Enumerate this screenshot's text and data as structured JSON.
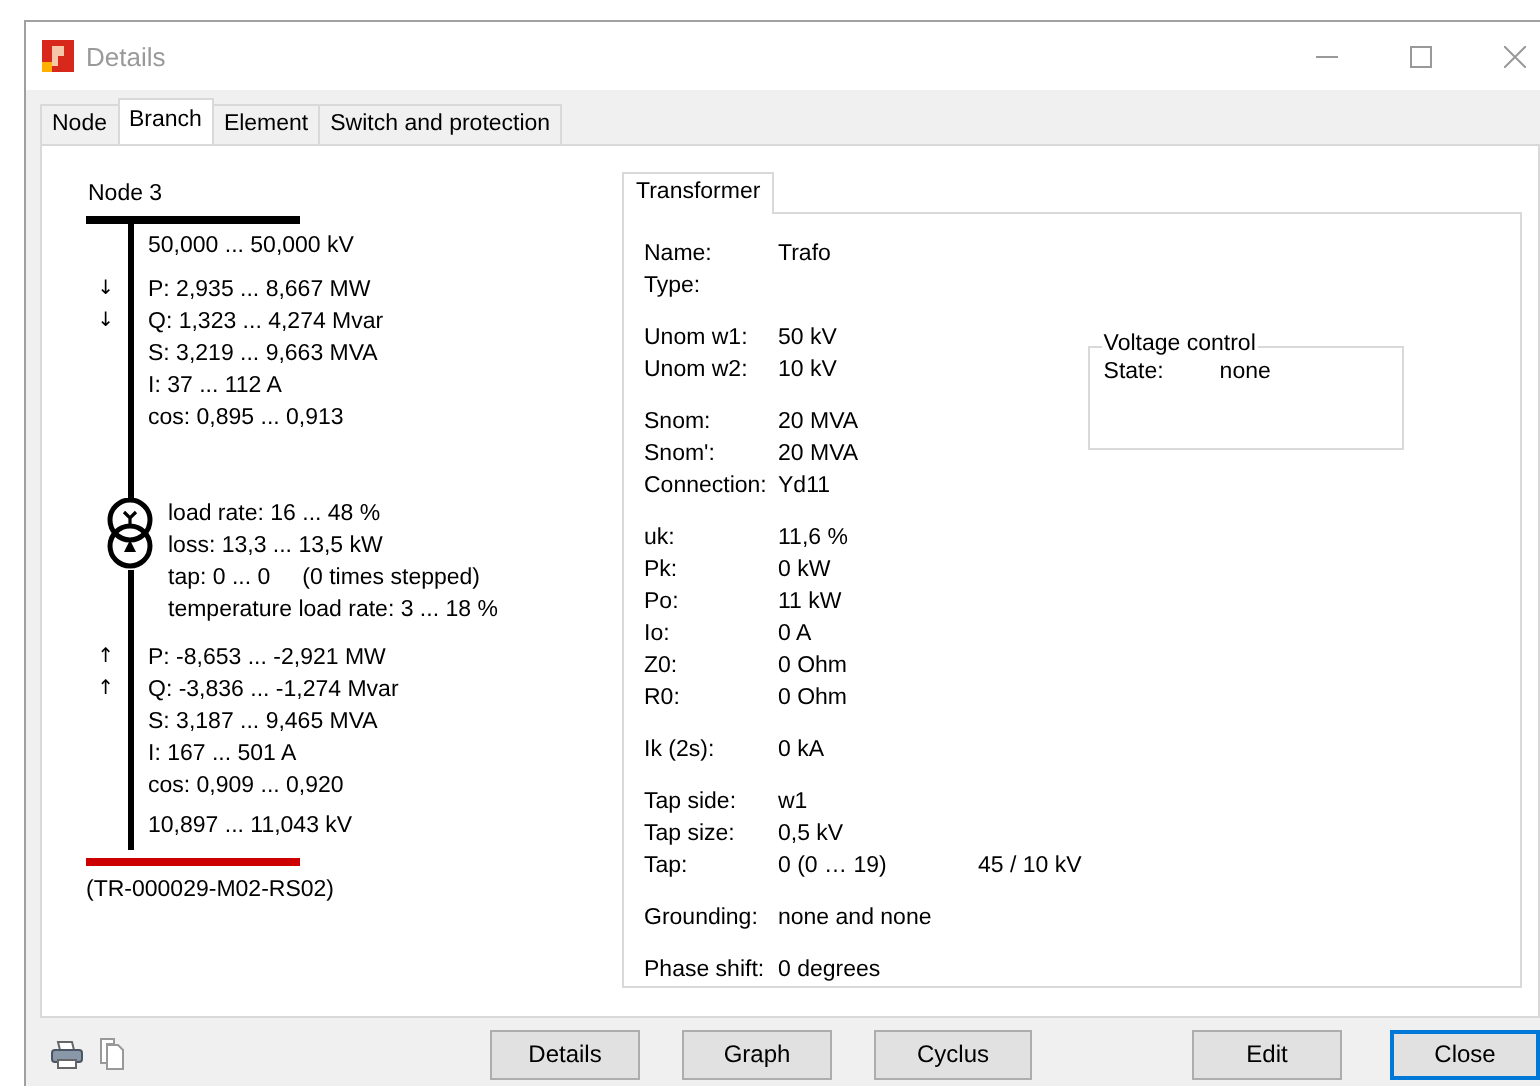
{
  "window": {
    "title": "Details"
  },
  "tabs": [
    {
      "label": "Node",
      "selected": false
    },
    {
      "label": "Branch",
      "selected": true
    },
    {
      "label": "Element",
      "selected": false
    },
    {
      "label": "Switch and protection",
      "selected": false
    }
  ],
  "branch": {
    "from_bus": {
      "label": "Node 3",
      "color": "#000000"
    },
    "from_side": {
      "voltage": "50,000 ... 50,000 kV",
      "flows": [
        {
          "text": "P: 2,935 ... 8,667 MW",
          "arrow": "↓"
        },
        {
          "text": "Q: 1,323 ... 4,274 Mvar",
          "arrow": "↓"
        },
        {
          "text": "S: 3,219 ... 9,663 MVA"
        },
        {
          "text": "I: 37 ... 112 A"
        },
        {
          "text": "cos: 0,895 ... 0,913"
        }
      ]
    },
    "transformer": [
      {
        "text": "load rate: 16 ... 48 %"
      },
      {
        "text": "loss: 13,3 ... 13,5 kW"
      },
      {
        "text": "tap: 0 ... 0",
        "note": "(0 times stepped)"
      },
      {
        "text": "temperature load rate: 3 ... 18 %"
      }
    ],
    "to_side": {
      "flows": [
        {
          "text": "P: -8,653 ... -2,921 MW",
          "arrow": "↑"
        },
        {
          "text": "Q: -3,836 ... -1,274 Mvar",
          "arrow": "↑"
        },
        {
          "text": "S: 3,187 ... 9,465 MVA"
        },
        {
          "text": "I: 167 ... 501 A"
        },
        {
          "text": "cos: 0,909 ... 0,920"
        }
      ],
      "voltage": "10,897 ... 11,043 kV"
    },
    "to_bus": {
      "label": "(TR-000029-M02-RS02)",
      "color": "#cc0000"
    }
  },
  "details": {
    "tabs": [
      {
        "label": "Transformer",
        "selected": true
      }
    ],
    "groups": [
      [
        {
          "label": "Name:",
          "value": "Trafo"
        },
        {
          "label": "Type:"
        }
      ],
      [
        {
          "label": "Unom w1:",
          "value": "50 kV"
        },
        {
          "label": "Unom w2:",
          "value": "10 kV"
        }
      ],
      [
        {
          "label": "Snom:",
          "value": "20 MVA"
        },
        {
          "label": "Snom':",
          "value": "20 MVA"
        },
        {
          "label": "Connection:",
          "value": "Yd11"
        }
      ],
      [
        {
          "label": "uk:",
          "value": "11,6 %"
        },
        {
          "label": "Pk:",
          "value": "0 kW"
        },
        {
          "label": "Po:",
          "value": "11 kW"
        },
        {
          "label": "Io:",
          "value": "0 A"
        },
        {
          "label": "Z0:",
          "value": "0 Ohm"
        },
        {
          "label": "R0:",
          "value": "0 Ohm"
        }
      ],
      [
        {
          "label": "Ik (2s):",
          "value": "0 kA"
        }
      ],
      [
        {
          "label": "Tap side:",
          "value": "w1"
        },
        {
          "label": "Tap size:",
          "value": "0,5 kV"
        },
        {
          "label": "Tap:",
          "value": "0 (0 … 19)",
          "extra": "45 / 10 kV"
        }
      ],
      [
        {
          "label": "Grounding:",
          "value": "none and none"
        }
      ],
      [
        {
          "label": "Phase shift:",
          "value": "0 degrees"
        }
      ]
    ],
    "voltage_control": {
      "title": "Voltage control",
      "rows": [
        {
          "label": "State:",
          "value": "none"
        }
      ]
    }
  },
  "actions": [
    {
      "label": "Details",
      "default": false
    },
    {
      "label": "Graph",
      "default": false
    },
    {
      "label": "Cyclus",
      "default": false
    }
  ],
  "dialog_buttons": [
    {
      "label": "Edit",
      "default": false
    },
    {
      "label": "Close",
      "default": true
    }
  ]
}
